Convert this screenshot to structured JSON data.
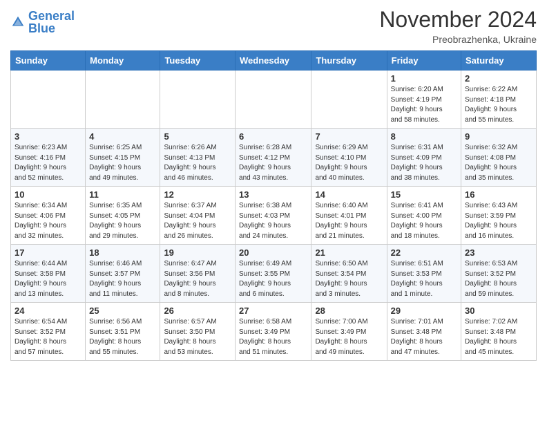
{
  "header": {
    "logo_general": "General",
    "logo_blue": "Blue",
    "month_title": "November 2024",
    "subtitle": "Preobrazhenka, Ukraine"
  },
  "weekdays": [
    "Sunday",
    "Monday",
    "Tuesday",
    "Wednesday",
    "Thursday",
    "Friday",
    "Saturday"
  ],
  "weeks": [
    [
      {
        "day": "",
        "info": ""
      },
      {
        "day": "",
        "info": ""
      },
      {
        "day": "",
        "info": ""
      },
      {
        "day": "",
        "info": ""
      },
      {
        "day": "",
        "info": ""
      },
      {
        "day": "1",
        "info": "Sunrise: 6:20 AM\nSunset: 4:19 PM\nDaylight: 9 hours\nand 58 minutes."
      },
      {
        "day": "2",
        "info": "Sunrise: 6:22 AM\nSunset: 4:18 PM\nDaylight: 9 hours\nand 55 minutes."
      }
    ],
    [
      {
        "day": "3",
        "info": "Sunrise: 6:23 AM\nSunset: 4:16 PM\nDaylight: 9 hours\nand 52 minutes."
      },
      {
        "day": "4",
        "info": "Sunrise: 6:25 AM\nSunset: 4:15 PM\nDaylight: 9 hours\nand 49 minutes."
      },
      {
        "day": "5",
        "info": "Sunrise: 6:26 AM\nSunset: 4:13 PM\nDaylight: 9 hours\nand 46 minutes."
      },
      {
        "day": "6",
        "info": "Sunrise: 6:28 AM\nSunset: 4:12 PM\nDaylight: 9 hours\nand 43 minutes."
      },
      {
        "day": "7",
        "info": "Sunrise: 6:29 AM\nSunset: 4:10 PM\nDaylight: 9 hours\nand 40 minutes."
      },
      {
        "day": "8",
        "info": "Sunrise: 6:31 AM\nSunset: 4:09 PM\nDaylight: 9 hours\nand 38 minutes."
      },
      {
        "day": "9",
        "info": "Sunrise: 6:32 AM\nSunset: 4:08 PM\nDaylight: 9 hours\nand 35 minutes."
      }
    ],
    [
      {
        "day": "10",
        "info": "Sunrise: 6:34 AM\nSunset: 4:06 PM\nDaylight: 9 hours\nand 32 minutes."
      },
      {
        "day": "11",
        "info": "Sunrise: 6:35 AM\nSunset: 4:05 PM\nDaylight: 9 hours\nand 29 minutes."
      },
      {
        "day": "12",
        "info": "Sunrise: 6:37 AM\nSunset: 4:04 PM\nDaylight: 9 hours\nand 26 minutes."
      },
      {
        "day": "13",
        "info": "Sunrise: 6:38 AM\nSunset: 4:03 PM\nDaylight: 9 hours\nand 24 minutes."
      },
      {
        "day": "14",
        "info": "Sunrise: 6:40 AM\nSunset: 4:01 PM\nDaylight: 9 hours\nand 21 minutes."
      },
      {
        "day": "15",
        "info": "Sunrise: 6:41 AM\nSunset: 4:00 PM\nDaylight: 9 hours\nand 18 minutes."
      },
      {
        "day": "16",
        "info": "Sunrise: 6:43 AM\nSunset: 3:59 PM\nDaylight: 9 hours\nand 16 minutes."
      }
    ],
    [
      {
        "day": "17",
        "info": "Sunrise: 6:44 AM\nSunset: 3:58 PM\nDaylight: 9 hours\nand 13 minutes."
      },
      {
        "day": "18",
        "info": "Sunrise: 6:46 AM\nSunset: 3:57 PM\nDaylight: 9 hours\nand 11 minutes."
      },
      {
        "day": "19",
        "info": "Sunrise: 6:47 AM\nSunset: 3:56 PM\nDaylight: 9 hours\nand 8 minutes."
      },
      {
        "day": "20",
        "info": "Sunrise: 6:49 AM\nSunset: 3:55 PM\nDaylight: 9 hours\nand 6 minutes."
      },
      {
        "day": "21",
        "info": "Sunrise: 6:50 AM\nSunset: 3:54 PM\nDaylight: 9 hours\nand 3 minutes."
      },
      {
        "day": "22",
        "info": "Sunrise: 6:51 AM\nSunset: 3:53 PM\nDaylight: 9 hours\nand 1 minute."
      },
      {
        "day": "23",
        "info": "Sunrise: 6:53 AM\nSunset: 3:52 PM\nDaylight: 8 hours\nand 59 minutes."
      }
    ],
    [
      {
        "day": "24",
        "info": "Sunrise: 6:54 AM\nSunset: 3:52 PM\nDaylight: 8 hours\nand 57 minutes."
      },
      {
        "day": "25",
        "info": "Sunrise: 6:56 AM\nSunset: 3:51 PM\nDaylight: 8 hours\nand 55 minutes."
      },
      {
        "day": "26",
        "info": "Sunrise: 6:57 AM\nSunset: 3:50 PM\nDaylight: 8 hours\nand 53 minutes."
      },
      {
        "day": "27",
        "info": "Sunrise: 6:58 AM\nSunset: 3:49 PM\nDaylight: 8 hours\nand 51 minutes."
      },
      {
        "day": "28",
        "info": "Sunrise: 7:00 AM\nSunset: 3:49 PM\nDaylight: 8 hours\nand 49 minutes."
      },
      {
        "day": "29",
        "info": "Sunrise: 7:01 AM\nSunset: 3:48 PM\nDaylight: 8 hours\nand 47 minutes."
      },
      {
        "day": "30",
        "info": "Sunrise: 7:02 AM\nSunset: 3:48 PM\nDaylight: 8 hours\nand 45 minutes."
      }
    ]
  ]
}
